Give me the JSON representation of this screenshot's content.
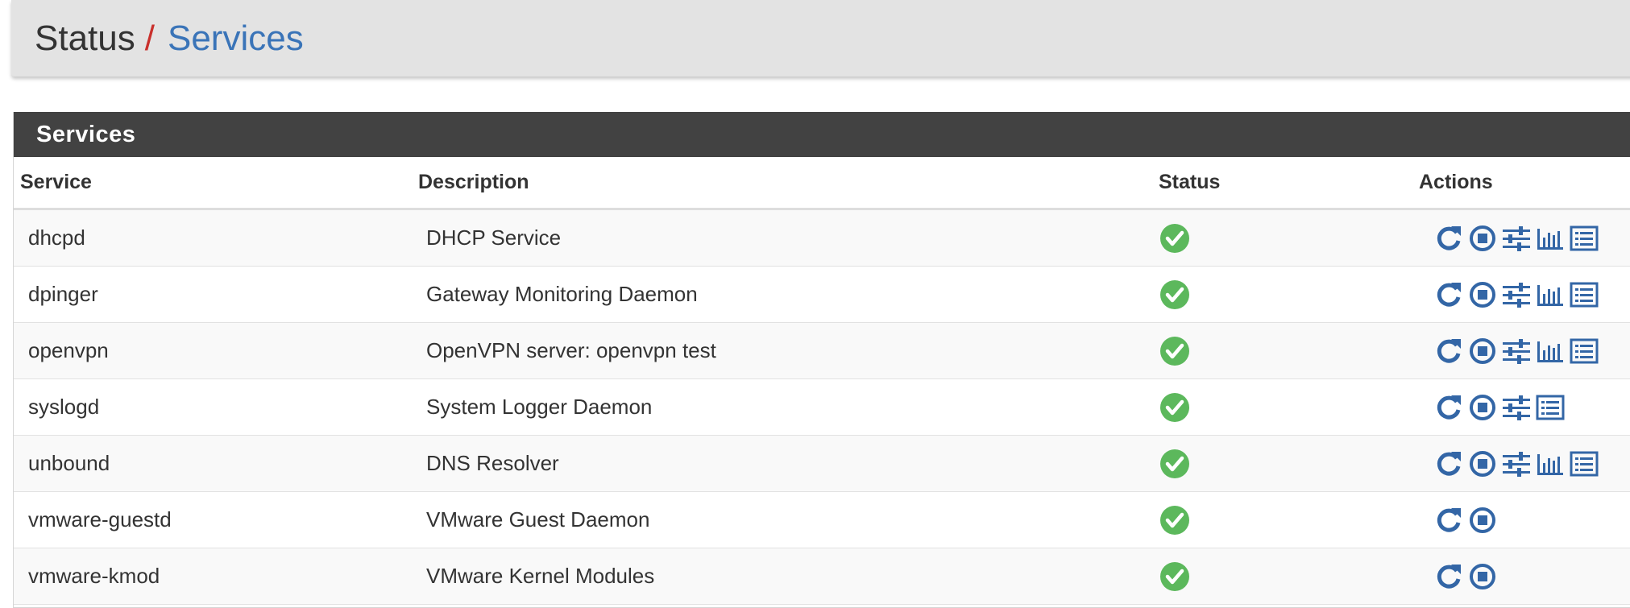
{
  "breadcrumb": {
    "root": "Status",
    "separator": "/",
    "current": "Services"
  },
  "panel": {
    "title": "Services"
  },
  "table": {
    "headers": [
      "Service",
      "Description",
      "Status",
      "Actions"
    ],
    "rows": [
      {
        "service": "dhcpd",
        "description": "DHCP Service",
        "status": "running",
        "actions": [
          "restart",
          "stop",
          "settings",
          "graph",
          "log"
        ]
      },
      {
        "service": "dpinger",
        "description": "Gateway Monitoring Daemon",
        "status": "running",
        "actions": [
          "restart",
          "stop",
          "settings",
          "graph",
          "log"
        ]
      },
      {
        "service": "openvpn",
        "description": "OpenVPN server: openvpn test",
        "status": "running",
        "actions": [
          "restart",
          "stop",
          "settings",
          "graph",
          "log"
        ]
      },
      {
        "service": "syslogd",
        "description": "System Logger Daemon",
        "status": "running",
        "actions": [
          "restart",
          "stop",
          "settings",
          "log"
        ]
      },
      {
        "service": "unbound",
        "description": "DNS Resolver",
        "status": "running",
        "actions": [
          "restart",
          "stop",
          "settings",
          "graph",
          "log"
        ]
      },
      {
        "service": "vmware-guestd",
        "description": "VMware Guest Daemon",
        "status": "running",
        "actions": [
          "restart",
          "stop"
        ]
      },
      {
        "service": "vmware-kmod",
        "description": "VMware Kernel Modules",
        "status": "running",
        "actions": [
          "restart",
          "stop"
        ]
      }
    ]
  },
  "colors": {
    "accent": "#3a74b8",
    "separator": "#c9302c",
    "status_running": "#5cb85c",
    "panel_heading": "#424242",
    "icon": "#3366a6"
  },
  "icons": {
    "restart": "restart-icon",
    "stop": "stop-icon",
    "settings": "settings-sliders-icon",
    "graph": "bar-chart-icon",
    "log": "log-list-icon",
    "running": "check-circle-icon"
  }
}
